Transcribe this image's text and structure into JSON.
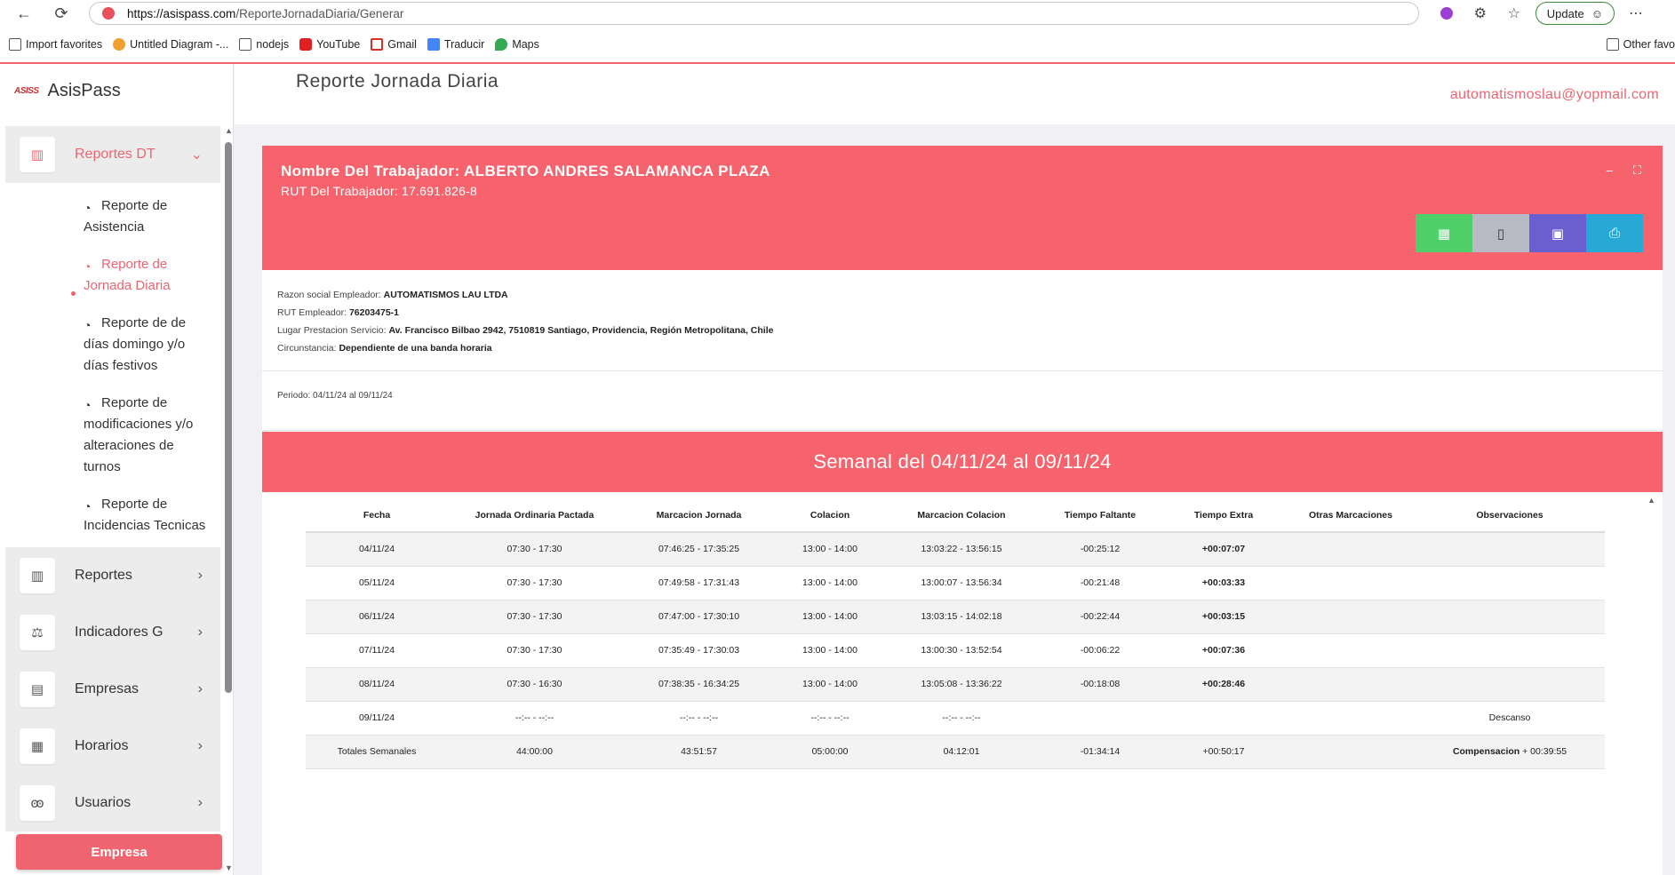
{
  "browser": {
    "url_host": "https://asispass.com",
    "url_path": "/ReporteJornadaDiaria/Generar",
    "update_label": "Update",
    "bookmarks": [
      {
        "label": "Import favorites",
        "color": "#555555"
      },
      {
        "label": "Untitled Diagram -...",
        "color": "#f0a030"
      },
      {
        "label": "nodejs",
        "color": "#555555"
      },
      {
        "label": "YouTube",
        "color": "#e02020"
      },
      {
        "label": "Gmail",
        "color": "#d93025"
      },
      {
        "label": "Traducir",
        "color": "#4285f4"
      },
      {
        "label": "Maps",
        "color": "#34a853"
      }
    ],
    "other_favorites": "Other favo"
  },
  "brand": {
    "logo_text": "ASISS",
    "name": "AsisPass"
  },
  "sidebar": {
    "active_group": {
      "label": "Reportes DT",
      "icon": "bar-chart-icon"
    },
    "subitems": [
      {
        "label": "Reporte de Asistencia",
        "active": false
      },
      {
        "label": "Reporte de Jornada Diaria",
        "active": true
      },
      {
        "label": "Reporte de de días domingo y/o días festivos",
        "active": false
      },
      {
        "label": "Reporte de modificaciones y/o alteraciones de turnos",
        "active": false
      },
      {
        "label": "Reporte de Incidencias Tecnicas",
        "active": false
      }
    ],
    "groups": [
      {
        "label": "Reportes",
        "icon": "bar-chart-icon"
      },
      {
        "label": "Indicadores G",
        "icon": "scale-icon"
      },
      {
        "label": "Empresas",
        "icon": "clipboard-icon"
      },
      {
        "label": "Horarios",
        "icon": "calendar-icon"
      },
      {
        "label": "Usuarios",
        "icon": "users-icon"
      }
    ],
    "empresa_button": "Empresa"
  },
  "header": {
    "title": "Reporte Jornada Diaria",
    "email": "automatismoslau@yopmail.com"
  },
  "report": {
    "worker_name": "Nombre Del Trabajador: ALBERTO ANDRES SALAMANCA PLAZA",
    "worker_rut": "RUT Del Trabajador: 17.691.826-8",
    "info": {
      "razon_label": "Razon social Empleador:",
      "razon_value": "AUTOMATISMOS LAU LTDA",
      "rut_label": "RUT Empleador:",
      "rut_value": "76203475-1",
      "lugar_label": "Lugar Prestacion Servicio:",
      "lugar_value": "Av. Francisco Bilbao 2942, 7510819 Santiago, Providencia, Región Metropolitana, Chile",
      "circ_label": "Circunstancia:",
      "circ_value": "Dependiente de una banda horaria"
    },
    "periodo": "Periodo: 04/11/24 al 09/11/24",
    "week_title": "Semanal del 04/11/24 al 09/11/24",
    "export_colors": {
      "excel": "#4fd06a",
      "pdf": "#b7b9c4",
      "word": "#6a5fd0",
      "print": "#27a9d6"
    }
  },
  "table": {
    "headers": [
      "Fecha",
      "Jornada Ordinaria Pactada",
      "Marcacion Jornada",
      "Colacion",
      "Marcacion Colacion",
      "Tiempo Faltante",
      "Tiempo Extra",
      "Otras Marcaciones",
      "Observaciones"
    ],
    "rows": [
      [
        "04/11/24",
        "07:30 - 17:30",
        "07:46:25 - 17:35:25",
        "13:00 - 14:00",
        "13:03:22 - 13:56:15",
        "-00:25:12",
        "+00:07:07",
        "",
        ""
      ],
      [
        "05/11/24",
        "07:30 - 17:30",
        "07:49:58 - 17:31:43",
        "13:00 - 14:00",
        "13:00:07 - 13:56:34",
        "-00:21:48",
        "+00:03:33",
        "",
        ""
      ],
      [
        "06/11/24",
        "07:30 - 17:30",
        "07:47:00 - 17:30:10",
        "13:00 - 14:00",
        "13:03:15 - 14:02:18",
        "-00:22:44",
        "+00:03:15",
        "",
        ""
      ],
      [
        "07/11/24",
        "07:30 - 17:30",
        "07:35:49 - 17:30:03",
        "13:00 - 14:00",
        "13:00:30 - 13:52:54",
        "-00:06:22",
        "+00:07:36",
        "",
        ""
      ],
      [
        "08/11/24",
        "07:30 - 16:30",
        "07:38:35 - 16:34:25",
        "13:00 - 14:00",
        "13:05:08 - 13:36:22",
        "-00:18:08",
        "+00:28:46",
        "",
        ""
      ],
      [
        "09/11/24",
        "--:-- - --:--",
        "--:-- - --:--",
        "--:-- - --:--",
        "--:-- - --:--",
        "",
        "",
        "",
        "Descanso"
      ]
    ],
    "totals": {
      "label": "Totales Semanales",
      "jornada": "44:00:00",
      "marcacion": "43:51:57",
      "colacion": "05:00:00",
      "marc_colacion": "04:12:01",
      "faltante": "-01:34:14",
      "extra": "+00:50:17",
      "otras": "",
      "obs_bold": "Compensacion",
      "obs_rest": " + 00:39:55"
    }
  }
}
